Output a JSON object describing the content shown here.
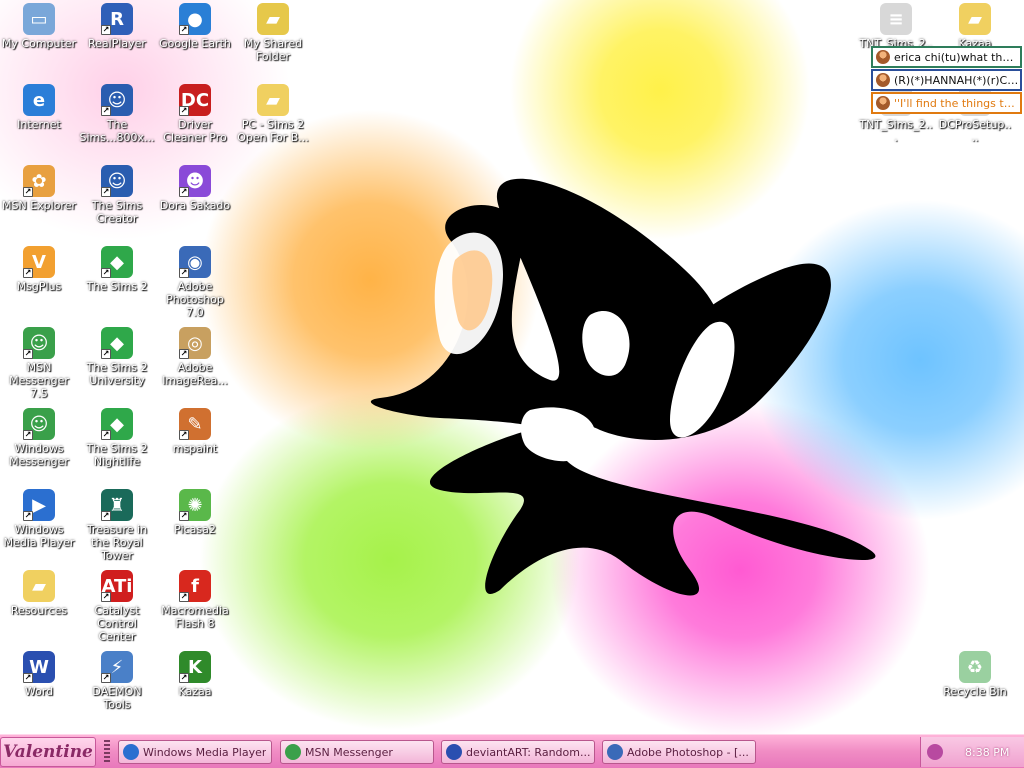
{
  "desktop": {
    "icons_left": [
      {
        "label": "My Computer",
        "icon": "my-computer-icon",
        "color": "#7aa7d9",
        "glyph": "▭",
        "shortcut": false
      },
      {
        "label": "RealPlayer",
        "icon": "realplayer-icon",
        "color": "#2f5fb8",
        "glyph": "R",
        "shortcut": true
      },
      {
        "label": "Google Earth",
        "icon": "google-earth-icon",
        "color": "#2a7fd6",
        "glyph": "●",
        "shortcut": true
      },
      {
        "label": "My Shared Folder",
        "icon": "shared-folder-icon",
        "color": "#e6c84a",
        "glyph": "▰",
        "shortcut": false
      },
      {
        "label": "Internet",
        "icon": "internet-explorer-icon",
        "color": "#2b7ed8",
        "glyph": "e",
        "shortcut": false
      },
      {
        "label": "The Sims...800x...",
        "icon": "the-sims-icon",
        "color": "#2a5db0",
        "glyph": "☺",
        "shortcut": true
      },
      {
        "label": "Driver Cleaner Pro",
        "icon": "driver-cleaner-icon",
        "color": "#c81e1e",
        "glyph": "DC",
        "shortcut": true
      },
      {
        "label": "PC - Sims 2 Open For B...",
        "icon": "folder-icon",
        "color": "#f0d060",
        "glyph": "▰",
        "shortcut": false
      },
      {
        "label": "MSN Explorer",
        "icon": "msn-explorer-icon",
        "color": "#e8a040",
        "glyph": "✿",
        "shortcut": true
      },
      {
        "label": "The Sims Creator",
        "icon": "sims-creator-icon",
        "color": "#2a5db0",
        "glyph": "☺",
        "shortcut": true
      },
      {
        "label": "Dora Sakado",
        "icon": "dora-sakado-icon",
        "color": "#8a4ad8",
        "glyph": "☻",
        "shortcut": true
      },
      {
        "label": "MsgPlus",
        "icon": "msgplus-icon",
        "color": "#f2a030",
        "glyph": "V",
        "shortcut": true
      },
      {
        "label": "The Sims 2",
        "icon": "sims2-icon",
        "color": "#2fa84a",
        "glyph": "◆",
        "shortcut": true
      },
      {
        "label": "Adobe Photoshop 7.0",
        "icon": "photoshop-icon",
        "color": "#3a6ab8",
        "glyph": "◉",
        "shortcut": true
      },
      {
        "label": "MSN Messenger 7.5",
        "icon": "msn-messenger-icon",
        "color": "#3aa04a",
        "glyph": "☺",
        "shortcut": true
      },
      {
        "label": "The Sims 2 University",
        "icon": "sims2-university-icon",
        "color": "#2fa84a",
        "glyph": "◆",
        "shortcut": true
      },
      {
        "label": "Adobe ImageRea...",
        "icon": "imageready-icon",
        "color": "#c8a060",
        "glyph": "◎",
        "shortcut": true
      },
      {
        "label": "Windows Messenger",
        "icon": "windows-messenger-icon",
        "color": "#3aa04a",
        "glyph": "☺",
        "shortcut": true
      },
      {
        "label": "The Sims 2 Nightlife",
        "icon": "sims2-nightlife-icon",
        "color": "#2fa84a",
        "glyph": "◆",
        "shortcut": true
      },
      {
        "label": "mspaint",
        "icon": "mspaint-icon",
        "color": "#d07030",
        "glyph": "✎",
        "shortcut": true
      },
      {
        "label": "Windows Media Player",
        "icon": "windows-media-player-icon",
        "color": "#2b6fd0",
        "glyph": "▶",
        "shortcut": true
      },
      {
        "label": "Treasure in the Royal Tower",
        "icon": "treasure-royal-tower-icon",
        "color": "#1a6a5a",
        "glyph": "♜",
        "shortcut": true
      },
      {
        "label": "Picasa2",
        "icon": "picasa-icon",
        "color": "#5ab84a",
        "glyph": "✺",
        "shortcut": true
      },
      {
        "label": "Resources",
        "icon": "folder-icon",
        "color": "#f0d060",
        "glyph": "▰",
        "shortcut": false
      },
      {
        "label": "Catalyst Control Center",
        "icon": "ati-catalyst-icon",
        "color": "#d01e1e",
        "glyph": "ATi",
        "shortcut": true
      },
      {
        "label": "Macromedia Flash 8",
        "icon": "flash-icon",
        "color": "#d8281e",
        "glyph": "f",
        "shortcut": true
      },
      {
        "label": "Word",
        "icon": "word-icon",
        "color": "#2a4fb0",
        "glyph": "W",
        "shortcut": true
      },
      {
        "label": "DAEMON Tools",
        "icon": "daemon-tools-icon",
        "color": "#4a80c8",
        "glyph": "⚡",
        "shortcut": true
      },
      {
        "label": "Kazaa",
        "icon": "kazaa-icon",
        "color": "#2f8a2a",
        "glyph": "K",
        "shortcut": true
      }
    ],
    "icons_right": [
      {
        "label": "TNT_Sims_2...",
        "icon": "text-file-icon",
        "color": "#d8d8d8",
        "glyph": "≡"
      },
      {
        "label": "Kazaa",
        "icon": "folder-icon",
        "color": "#f0d060",
        "glyph": "▰"
      },
      {
        "label": "TNT_Sims_2...",
        "icon": "text-file-icon",
        "color": "#d8d8d8",
        "glyph": "≡"
      },
      {
        "label": "DCProSetup....",
        "icon": "setup-file-icon",
        "color": "#d8d8d8",
        "glyph": "≡"
      },
      {
        "label": "Recycle Bin",
        "icon": "recycle-bin-icon",
        "color": "#9ad0a0",
        "glyph": "♻"
      }
    ]
  },
  "notifications": [
    {
      "text": "erica chi(tu)what the f...",
      "border": "#2e7d5b",
      "color": "#111111"
    },
    {
      "text": "(R)(*)HANNAH(*)(r)Cl...",
      "border": "#2b4f9a",
      "color": "#111111"
    },
    {
      "text": "''I'll find the things they ...",
      "border": "#e07a10",
      "color": "#e07a10"
    }
  ],
  "taskbar": {
    "start_label": "Valentine",
    "tasks": [
      {
        "title": "Windows Media Player",
        "icon": "windows-media-player-icon"
      },
      {
        "title": "MSN Messenger",
        "icon": "msn-messenger-icon"
      },
      {
        "title": "deviantART: Random...",
        "icon": "browser-icon"
      },
      {
        "title": "Adobe Photoshop - [...",
        "icon": "photoshop-icon"
      }
    ],
    "clock": "8:38 PM"
  },
  "colors": {
    "taskbar": "#f08cc4",
    "start_text": "#8a2a66"
  }
}
